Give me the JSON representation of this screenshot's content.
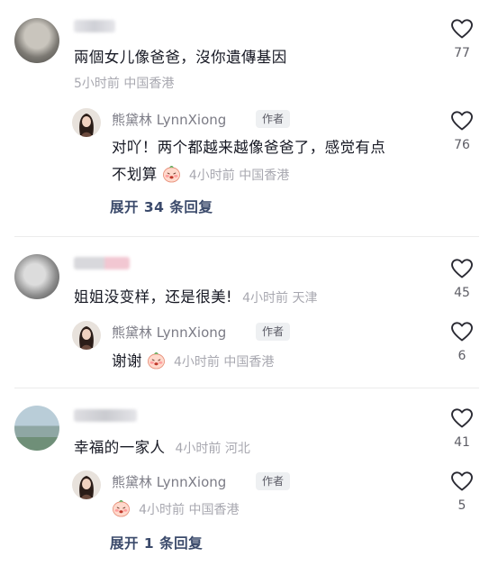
{
  "comments": [
    {
      "author_blurred": true,
      "text": "兩個女儿像爸爸，沒你遺傳基因",
      "meta": "5小时前 中国香港",
      "likes": "77",
      "reply": {
        "author": "熊黛林 LynnXiong",
        "tag": "作者",
        "text_line1": "对吖！两个都越来越像爸爸了，感觉有点",
        "text_line2": "不划算",
        "meta": "4小时前 中国香港",
        "likes": "76"
      },
      "expand": "展开 34 条回复"
    },
    {
      "author_blurred": true,
      "text": "姐姐没变样，还是很美!",
      "meta": "4小时前 天津",
      "likes": "45",
      "reply": {
        "author": "熊黛林 LynnXiong",
        "tag": "作者",
        "text": "谢谢",
        "meta": "4小时前 中国香港",
        "likes": "6"
      }
    },
    {
      "author_blurred": true,
      "text": "幸福的一家人",
      "meta": "4小时前 河北",
      "likes": "41",
      "reply": {
        "author": "熊黛林 LynnXiong",
        "tag": "作者",
        "meta": "4小时前 中国香港",
        "likes": "5"
      },
      "expand": "展开 1 条回复"
    }
  ],
  "colors": {
    "text": "#161823",
    "meta": "#a8a8b0",
    "expand": "#3b4a6b",
    "tag_bg": "#eef0f2"
  },
  "icons": [
    "heart-outline-icon",
    "blushing-peach-sticker"
  ]
}
